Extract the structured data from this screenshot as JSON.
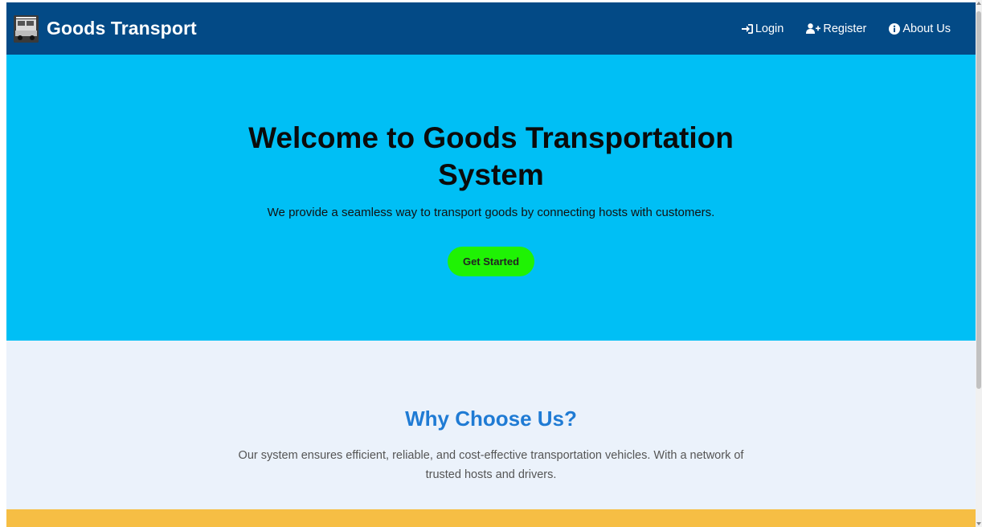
{
  "navbar": {
    "brand": "Goods Transport",
    "logo_icon": "truck-logo-icon",
    "links": [
      {
        "label": "Login",
        "icon": "sign-in-icon"
      },
      {
        "label": "Register",
        "icon": "user-plus-icon"
      },
      {
        "label": "About Us",
        "icon": "info-circle-icon"
      }
    ],
    "bg_color": "#034a86"
  },
  "hero": {
    "title": "Welcome to Goods Transportation System",
    "subtitle": "We provide a seamless way to transport goods by connecting hosts with customers.",
    "cta_label": "Get Started",
    "bg_color": "#00bff5",
    "cta_color": "#1ff204"
  },
  "why": {
    "title": "Why Choose Us?",
    "text": "Our system ensures efficient, reliable, and cost-effective transportation vehicles. With a network of trusted hosts and drivers.",
    "title_color": "#1f7bd4",
    "bg_color": "#ebf2fb"
  },
  "footer_band_color": "#f6be44"
}
